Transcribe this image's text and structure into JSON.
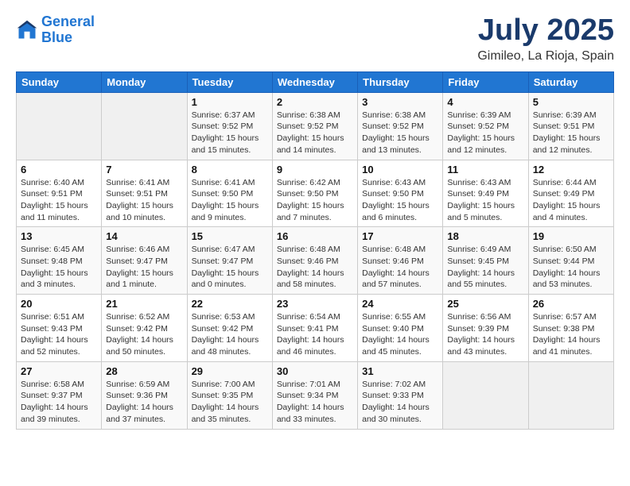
{
  "logo": {
    "line1": "General",
    "line2": "Blue"
  },
  "header": {
    "month": "July 2025",
    "location": "Gimileo, La Rioja, Spain"
  },
  "days_of_week": [
    "Sunday",
    "Monday",
    "Tuesday",
    "Wednesday",
    "Thursday",
    "Friday",
    "Saturday"
  ],
  "weeks": [
    [
      {
        "day": "",
        "info": ""
      },
      {
        "day": "",
        "info": ""
      },
      {
        "day": "1",
        "info": "Sunrise: 6:37 AM\nSunset: 9:52 PM\nDaylight: 15 hours and 15 minutes."
      },
      {
        "day": "2",
        "info": "Sunrise: 6:38 AM\nSunset: 9:52 PM\nDaylight: 15 hours and 14 minutes."
      },
      {
        "day": "3",
        "info": "Sunrise: 6:38 AM\nSunset: 9:52 PM\nDaylight: 15 hours and 13 minutes."
      },
      {
        "day": "4",
        "info": "Sunrise: 6:39 AM\nSunset: 9:52 PM\nDaylight: 15 hours and 12 minutes."
      },
      {
        "day": "5",
        "info": "Sunrise: 6:39 AM\nSunset: 9:51 PM\nDaylight: 15 hours and 12 minutes."
      }
    ],
    [
      {
        "day": "6",
        "info": "Sunrise: 6:40 AM\nSunset: 9:51 PM\nDaylight: 15 hours and 11 minutes."
      },
      {
        "day": "7",
        "info": "Sunrise: 6:41 AM\nSunset: 9:51 PM\nDaylight: 15 hours and 10 minutes."
      },
      {
        "day": "8",
        "info": "Sunrise: 6:41 AM\nSunset: 9:50 PM\nDaylight: 15 hours and 9 minutes."
      },
      {
        "day": "9",
        "info": "Sunrise: 6:42 AM\nSunset: 9:50 PM\nDaylight: 15 hours and 7 minutes."
      },
      {
        "day": "10",
        "info": "Sunrise: 6:43 AM\nSunset: 9:50 PM\nDaylight: 15 hours and 6 minutes."
      },
      {
        "day": "11",
        "info": "Sunrise: 6:43 AM\nSunset: 9:49 PM\nDaylight: 15 hours and 5 minutes."
      },
      {
        "day": "12",
        "info": "Sunrise: 6:44 AM\nSunset: 9:49 PM\nDaylight: 15 hours and 4 minutes."
      }
    ],
    [
      {
        "day": "13",
        "info": "Sunrise: 6:45 AM\nSunset: 9:48 PM\nDaylight: 15 hours and 3 minutes."
      },
      {
        "day": "14",
        "info": "Sunrise: 6:46 AM\nSunset: 9:47 PM\nDaylight: 15 hours and 1 minute."
      },
      {
        "day": "15",
        "info": "Sunrise: 6:47 AM\nSunset: 9:47 PM\nDaylight: 15 hours and 0 minutes."
      },
      {
        "day": "16",
        "info": "Sunrise: 6:48 AM\nSunset: 9:46 PM\nDaylight: 14 hours and 58 minutes."
      },
      {
        "day": "17",
        "info": "Sunrise: 6:48 AM\nSunset: 9:46 PM\nDaylight: 14 hours and 57 minutes."
      },
      {
        "day": "18",
        "info": "Sunrise: 6:49 AM\nSunset: 9:45 PM\nDaylight: 14 hours and 55 minutes."
      },
      {
        "day": "19",
        "info": "Sunrise: 6:50 AM\nSunset: 9:44 PM\nDaylight: 14 hours and 53 minutes."
      }
    ],
    [
      {
        "day": "20",
        "info": "Sunrise: 6:51 AM\nSunset: 9:43 PM\nDaylight: 14 hours and 52 minutes."
      },
      {
        "day": "21",
        "info": "Sunrise: 6:52 AM\nSunset: 9:42 PM\nDaylight: 14 hours and 50 minutes."
      },
      {
        "day": "22",
        "info": "Sunrise: 6:53 AM\nSunset: 9:42 PM\nDaylight: 14 hours and 48 minutes."
      },
      {
        "day": "23",
        "info": "Sunrise: 6:54 AM\nSunset: 9:41 PM\nDaylight: 14 hours and 46 minutes."
      },
      {
        "day": "24",
        "info": "Sunrise: 6:55 AM\nSunset: 9:40 PM\nDaylight: 14 hours and 45 minutes."
      },
      {
        "day": "25",
        "info": "Sunrise: 6:56 AM\nSunset: 9:39 PM\nDaylight: 14 hours and 43 minutes."
      },
      {
        "day": "26",
        "info": "Sunrise: 6:57 AM\nSunset: 9:38 PM\nDaylight: 14 hours and 41 minutes."
      }
    ],
    [
      {
        "day": "27",
        "info": "Sunrise: 6:58 AM\nSunset: 9:37 PM\nDaylight: 14 hours and 39 minutes."
      },
      {
        "day": "28",
        "info": "Sunrise: 6:59 AM\nSunset: 9:36 PM\nDaylight: 14 hours and 37 minutes."
      },
      {
        "day": "29",
        "info": "Sunrise: 7:00 AM\nSunset: 9:35 PM\nDaylight: 14 hours and 35 minutes."
      },
      {
        "day": "30",
        "info": "Sunrise: 7:01 AM\nSunset: 9:34 PM\nDaylight: 14 hours and 33 minutes."
      },
      {
        "day": "31",
        "info": "Sunrise: 7:02 AM\nSunset: 9:33 PM\nDaylight: 14 hours and 30 minutes."
      },
      {
        "day": "",
        "info": ""
      },
      {
        "day": "",
        "info": ""
      }
    ]
  ]
}
